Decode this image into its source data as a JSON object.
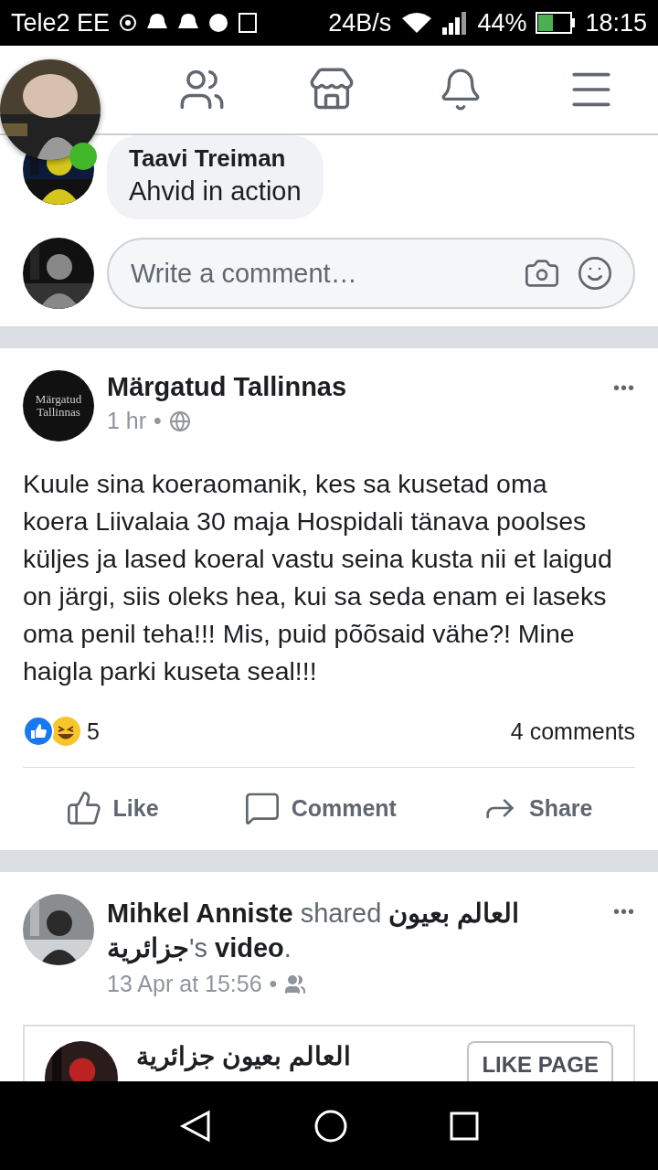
{
  "status_bar": {
    "carrier": "Tele2 EE",
    "speed": "24B/s",
    "battery": "44%",
    "time": "18:15"
  },
  "chat_head": {
    "online": true
  },
  "comment": {
    "author": "Taavi Treiman",
    "text": "Ahvid in action"
  },
  "comment_input": {
    "placeholder": "Write a comment…"
  },
  "posts": [
    {
      "kind": "status",
      "author": "Märgatud Tallinnas",
      "avatar_text": [
        "Märgatud",
        "Tallinnas"
      ],
      "time": "1 hr",
      "separator": "•",
      "more": "•••",
      "body": "Kuule sina koeraomanik, kes sa kusetad oma koera Liivalaia 30 maja Hospidali tänava poolses küljes ja lased koeral vastu seina kusta nii et laigud on järgi, siis oleks hea, kui sa seda enam ei laseks oma penil teha!!! Mis, puid põõsaid vähe?! Mine haigla parki kuseta seal!!!",
      "reaction_count": "5",
      "comment_count": "4 comments",
      "actions": [
        "Like",
        "Comment",
        "Share"
      ]
    },
    {
      "kind": "share",
      "header": "**Mihkel Anniste** shared **العالم بعيون جزائرية**'s **video**.",
      "time": "13 Apr at 15:56",
      "separator": "•",
      "more": "•••",
      "page_name": "العالم بعيون جزائرية",
      "like_page": "LIKE PAGE"
    }
  ]
}
